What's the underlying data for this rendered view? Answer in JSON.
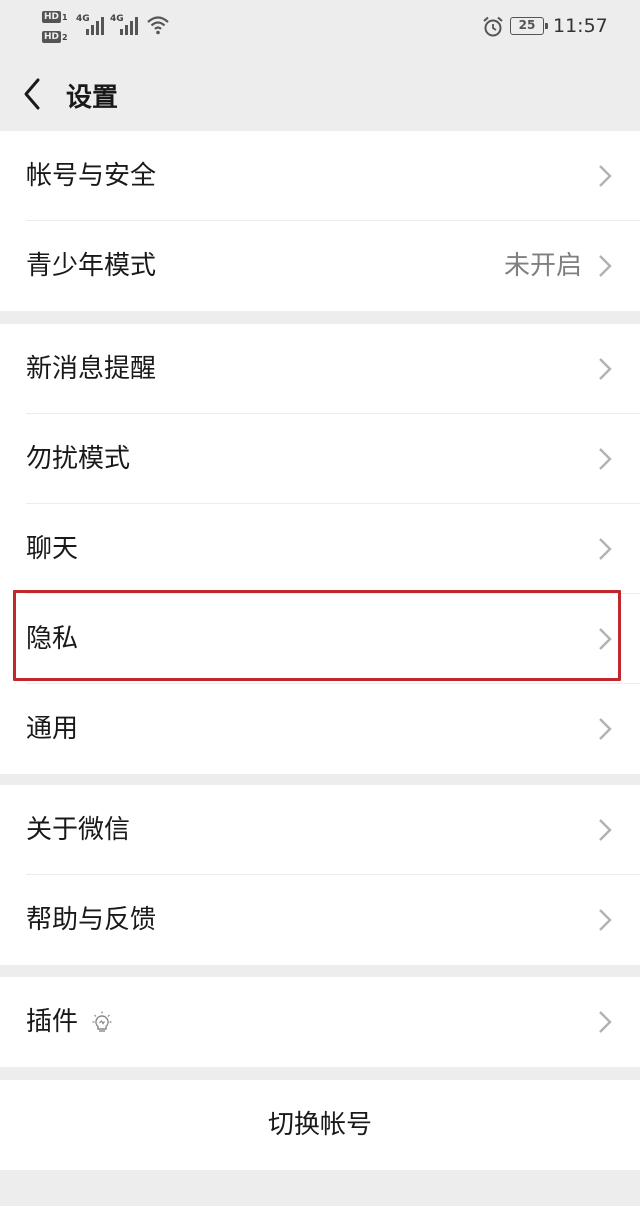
{
  "status_bar": {
    "hd1": "HD",
    "hd1_num": "1",
    "hd2": "HD",
    "hd2_num": "2",
    "sig1_tag": "4G",
    "sig2_tag": "4G",
    "battery": "25",
    "time": "11:57",
    "icons": [
      "signal-icon",
      "wifi-icon",
      "alarm-icon",
      "battery-icon"
    ]
  },
  "nav": {
    "back_icon": "chevron-left-icon",
    "title": "设置"
  },
  "groups": {
    "account": {
      "account_security": "帐号与安全",
      "teen_mode": "青少年模式",
      "teen_mode_value": "未开启"
    },
    "general": {
      "notifications": "新消息提醒",
      "dnd": "勿扰模式",
      "chat": "聊天",
      "privacy": "隐私",
      "general": "通用"
    },
    "about": {
      "about_wechat": "关于微信",
      "help": "帮助与反馈"
    },
    "plugins": {
      "plugins": "插件",
      "plugin_icon": "lightbulb-icon"
    },
    "switch_account": "切换帐号"
  },
  "colors": {
    "background": "#ededed",
    "row_background": "#ffffff",
    "highlight_border": "#c0282d",
    "secondary_text": "#808080"
  }
}
